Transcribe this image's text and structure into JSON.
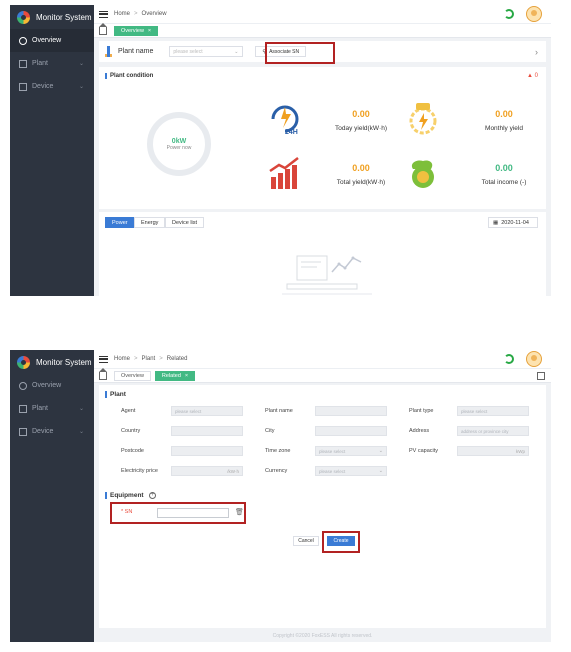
{
  "app": {
    "title": "Monitor System"
  },
  "sidebar": {
    "items": [
      {
        "label": "Overview",
        "icon": "dashboard-icon"
      },
      {
        "label": "Plant",
        "icon": "plant-icon"
      },
      {
        "label": "Device",
        "icon": "device-icon"
      }
    ]
  },
  "screen1": {
    "breadcrumb": [
      "Home",
      "Overview"
    ],
    "tabs": [
      {
        "label": "Overview",
        "close": "×"
      }
    ],
    "plant_bar": {
      "label": "Plant name",
      "select_placeholder": "please select",
      "associate_label": "Associate SN"
    },
    "condition": {
      "title": "Plant condition",
      "alarm_count": "0",
      "power_value": "0kW",
      "power_label": "Power now",
      "stats": [
        {
          "value": "0.00",
          "label": "Today yield(kW·h)"
        },
        {
          "value": "0.00",
          "label": "Monthly yield"
        },
        {
          "value": "0.00",
          "label": "Total yield(kW·h)"
        },
        {
          "value": "0.00",
          "label": "Total income (-)"
        }
      ],
      "icon_24h_text": "24H"
    },
    "chart_tabs": [
      "Power",
      "Energy",
      "Device list"
    ],
    "date": "2020-11-04"
  },
  "screen2": {
    "breadcrumb": [
      "Home",
      "Plant",
      "Related"
    ],
    "tabs": [
      {
        "label": "Overview"
      },
      {
        "label": "Related",
        "close": "×"
      }
    ],
    "plant_section": {
      "title": "Plant",
      "fields": [
        {
          "label": "Agent",
          "placeholder": "please select"
        },
        {
          "label": "Plant name",
          "placeholder": ""
        },
        {
          "label": "Plant type",
          "placeholder": "please select"
        },
        {
          "label": "Country",
          "placeholder": ""
        },
        {
          "label": "City",
          "placeholder": ""
        },
        {
          "label": "Address",
          "placeholder": "address or province city"
        },
        {
          "label": "Postcode",
          "placeholder": ""
        },
        {
          "label": "Time zone",
          "placeholder": "please select"
        },
        {
          "label": "PV capacity",
          "placeholder": "",
          "unit": "kWp"
        },
        {
          "label": "Electricity price",
          "placeholder": "",
          "unit": "/kW·h"
        },
        {
          "label": "Currency",
          "placeholder": "please select"
        }
      ]
    },
    "equipment_section": {
      "title": "Equipment",
      "sn_label": "* SN"
    },
    "buttons": {
      "cancel": "Cancel",
      "create": "Create"
    },
    "footer": "Copyright ©2020 FoxESS All rights reserved."
  },
  "colors": {
    "sidebar": "#2d3440",
    "accent_green": "#42b983",
    "accent_blue": "#3a7bd5",
    "highlight_red": "#b22222",
    "yield_orange": "#f0a020"
  }
}
